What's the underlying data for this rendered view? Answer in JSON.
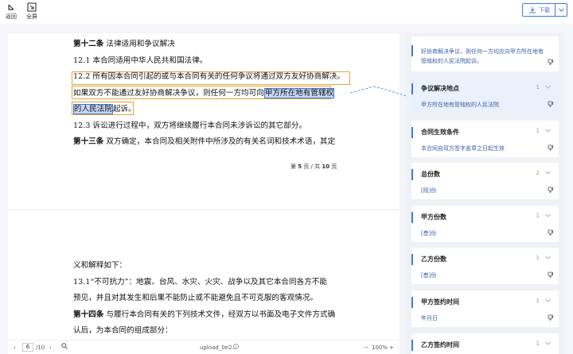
{
  "toolbar": {
    "back_label": "返回",
    "fullscreen_label": "全屏",
    "download_label": "下载"
  },
  "document": {
    "page1_lines": [
      {
        "bold": "第十二条",
        "text": " 法律适用和争议解决"
      },
      {
        "bold": "",
        "text": "12.1 本合同适用中华人民共和国法律。"
      },
      {
        "bold": "",
        "text": "12.2 所有因本合同引起的或与本合同有关的任何争议将通过双方友好协商解决。"
      },
      {
        "bold": "",
        "text": "如果双方不能通过友好协商解决争议，则任何一方均可向甲方所在地有管辖权"
      },
      {
        "bold": "",
        "text": "的人民法院起诉。"
      },
      {
        "bold": "",
        "text": "12.3 诉讼进行过程中，双方将继续履行本合同未涉诉讼的其它部分。"
      },
      {
        "bold": "第十三条",
        "text": " 双方确定，本合同及相关附件中所涉及的有关名词和技术术语，其定"
      }
    ],
    "line4_plain": "如果双方不能通过友好协商解决争议，则任何一方均可向",
    "line4_sel": "甲方所在地有管辖权",
    "line5_sel": "的人民法院",
    "line5_plain": "起诉。",
    "page_footer": {
      "prefix": "第 ",
      "current": "5",
      "middle": " 页 / 共 ",
      "total": "10",
      "suffix": " 页"
    },
    "page2_lines": [
      {
        "bold": "",
        "text": "义和解释如下："
      },
      {
        "bold": "",
        "text": "13.1“不可抗力”：地震、台风、水灾、火灾、战争以及其它本合同各方不能"
      },
      {
        "bold": "",
        "text": "预见，并且对其发生和后果不能防止或不能避免且不可克服的客观情况。"
      },
      {
        "bold": "第十四条",
        "text": " 与履行本合同有关的下列技术文件，经双方以书面及电子文件方式确"
      },
      {
        "bold": "",
        "text": "认后，为本合同的组成部分："
      }
    ]
  },
  "bottombar": {
    "page_current": "6",
    "page_total": "/10",
    "filename": "upload_0e2...",
    "zoom": "100%"
  },
  "panel": {
    "first_card_text": "好协商解决争议，则任何一方均应向甲方所在地有管辖权的人民法院起诉。",
    "cards": [
      {
        "title": "争议解决地点",
        "count": "1",
        "value": "甲方所在地有管辖权的人民法院",
        "active": true
      },
      {
        "title": "合同生效条件",
        "count": "1",
        "value": "本合同自双方签字盖章之日起生效",
        "active": false
      },
      {
        "title": "总份数",
        "count": "2",
        "value": "[陆]份",
        "active": false
      },
      {
        "title": "甲方份数",
        "count": "1",
        "value": "[叁]份",
        "active": false
      },
      {
        "title": "乙方份数",
        "count": "1",
        "value": "[叁]份",
        "active": false
      },
      {
        "title": "甲方签约时间",
        "count": "1",
        "value": "年月日",
        "active": false
      },
      {
        "title": "乙方签约时间",
        "count": "1",
        "value": "",
        "active": false
      }
    ]
  },
  "colors": {
    "accent": "#3b78e7",
    "highlight_border": "#e6a23c",
    "selection": "#c8d8f6"
  }
}
